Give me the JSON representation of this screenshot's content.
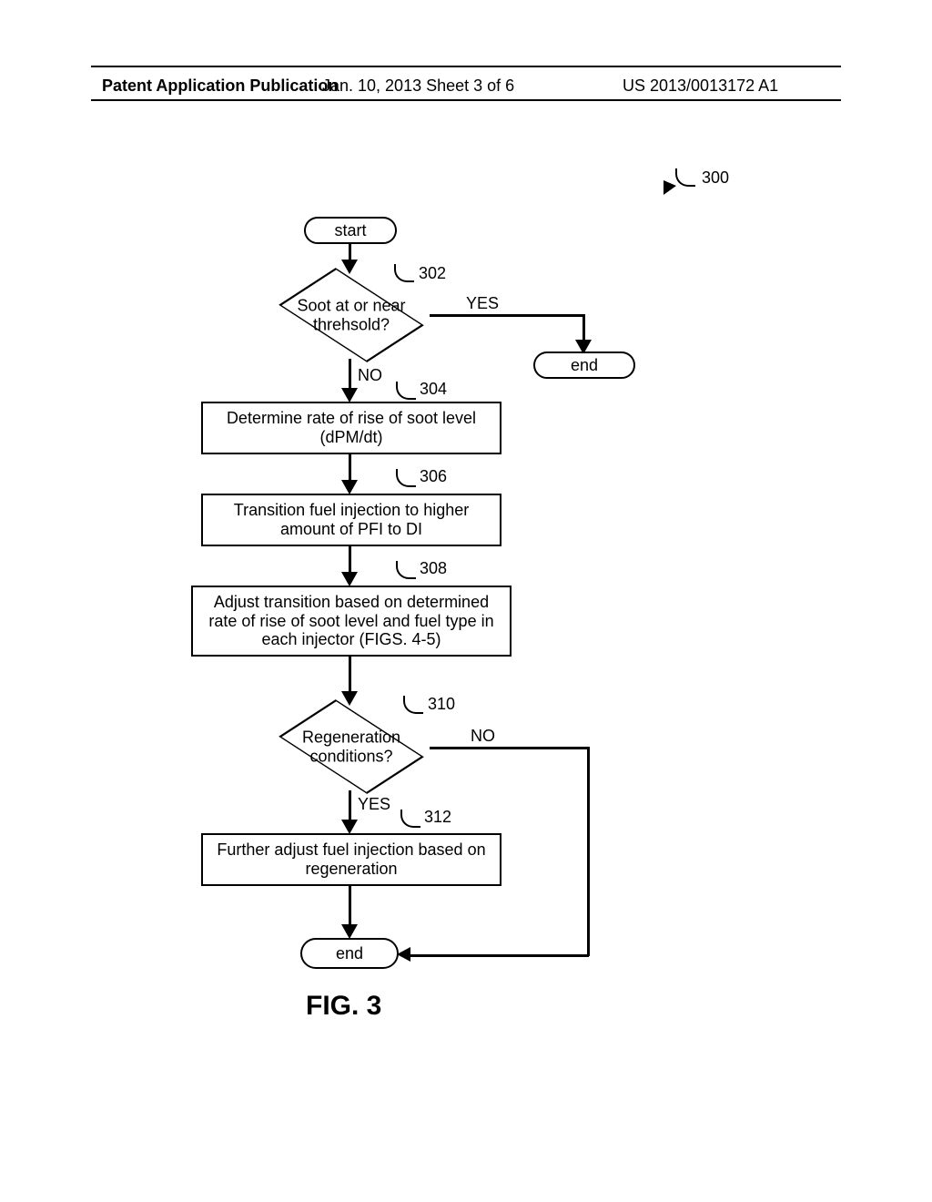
{
  "header": {
    "left": "Patent Application Publication",
    "mid": "Jan. 10, 2013  Sheet 3 of 6",
    "right": "US 2013/0013172 A1"
  },
  "ref300": "300",
  "start": "start",
  "end_top": "end",
  "end_bottom": "end",
  "d302": {
    "ref": "302",
    "text": "Soot at or near\nthrehsold?",
    "yes": "YES",
    "no": "NO"
  },
  "b304": {
    "ref": "304",
    "text": "Determine rate of rise of soot level\n(dPM/dt)"
  },
  "b306": {
    "ref": "306",
    "text": "Transition fuel injection to higher\namount of PFI to DI"
  },
  "b308": {
    "ref": "308",
    "text": "Adjust transition based on determined\nrate of rise of soot level and fuel type in\neach injector (FIGS. 4-5)"
  },
  "d310": {
    "ref": "310",
    "text": "Regeneration\nconditions?",
    "yes": "YES",
    "no": "NO"
  },
  "b312": {
    "ref": "312",
    "text": "Further adjust fuel injection based on\nregeneration"
  },
  "fig": "FIG. 3",
  "chart_data": {
    "type": "flowchart",
    "title": "FIG. 3",
    "ref": "300",
    "nodes": [
      {
        "id": "start",
        "kind": "terminator",
        "text": "start"
      },
      {
        "id": "302",
        "kind": "decision",
        "text": "Soot at or near threhsold?"
      },
      {
        "id": "end_top",
        "kind": "terminator",
        "text": "end"
      },
      {
        "id": "304",
        "kind": "process",
        "text": "Determine rate of rise of soot level (dPM/dt)"
      },
      {
        "id": "306",
        "kind": "process",
        "text": "Transition fuel injection to higher amount of PFI to DI"
      },
      {
        "id": "308",
        "kind": "process",
        "text": "Adjust transition based on determined rate of rise of soot level and fuel type in each injector (FIGS. 4-5)"
      },
      {
        "id": "310",
        "kind": "decision",
        "text": "Regeneration conditions?"
      },
      {
        "id": "312",
        "kind": "process",
        "text": "Further adjust fuel injection based on regeneration"
      },
      {
        "id": "end_bottom",
        "kind": "terminator",
        "text": "end"
      }
    ],
    "edges": [
      {
        "from": "start",
        "to": "302",
        "label": ""
      },
      {
        "from": "302",
        "to": "end_top",
        "label": "YES"
      },
      {
        "from": "302",
        "to": "304",
        "label": "NO"
      },
      {
        "from": "304",
        "to": "306",
        "label": ""
      },
      {
        "from": "306",
        "to": "308",
        "label": ""
      },
      {
        "from": "308",
        "to": "310",
        "label": ""
      },
      {
        "from": "310",
        "to": "312",
        "label": "YES"
      },
      {
        "from": "310",
        "to": "end_bottom",
        "label": "NO"
      },
      {
        "from": "312",
        "to": "end_bottom",
        "label": ""
      }
    ]
  }
}
